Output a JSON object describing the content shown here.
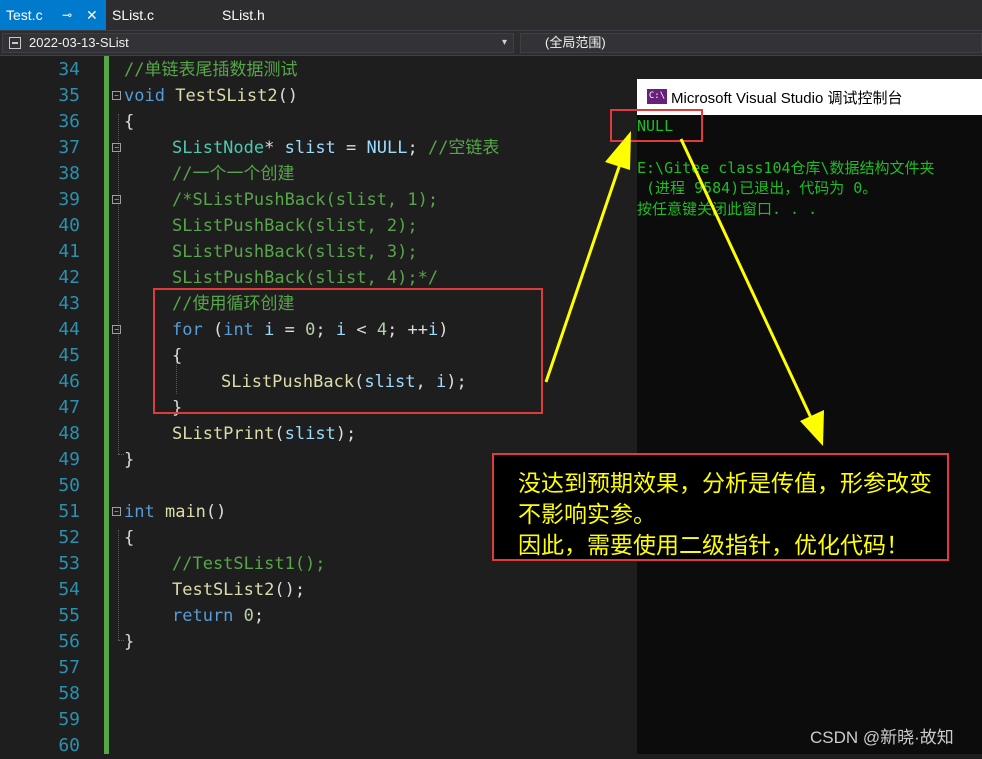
{
  "tabs": [
    {
      "label": "Test.c",
      "active": true,
      "pin": "⊸",
      "close": "✕"
    },
    {
      "label": "SList.c",
      "active": false
    },
    {
      "label": "SList.h",
      "active": false
    }
  ],
  "navbar": {
    "project": "2022-03-13-SList",
    "scope": "(全局范围)",
    "dropdown_arrow": "▾"
  },
  "editor": {
    "line_numbers": [
      "34",
      "35",
      "36",
      "37",
      "38",
      "39",
      "40",
      "41",
      "42",
      "43",
      "44",
      "45",
      "46",
      "47",
      "48",
      "49",
      "50",
      "51",
      "52",
      "53",
      "54",
      "55",
      "56",
      "57",
      "58",
      "59",
      "60"
    ],
    "code": {
      "l34": "//单链表尾插数据测试",
      "l35_kw": "void",
      "l35_fn": "TestSList2",
      "l35_rest": "()",
      "l36": "{",
      "l37_type": "SListNode",
      "l37_mid": "* ",
      "l37_var": "slist",
      "l37_eq": " = ",
      "l37_null": "NULL",
      "l37_semi": "; ",
      "l37_comment": "//空链表",
      "l38": "//一个一个创建",
      "l39": "/*SListPushBack(slist, 1);",
      "l40": "SListPushBack(slist, 2);",
      "l41": "SListPushBack(slist, 3);",
      "l42": "SListPushBack(slist, 4);*/",
      "l43": "//使用循环创建",
      "l44_for": "for",
      "l44_open": " (",
      "l44_int": "int",
      "l44_i1": " i",
      "l44_eq": " = ",
      "l44_zero": "0",
      "l44_semi1": "; ",
      "l44_i2": "i",
      "l44_lt": " < ",
      "l44_four": "4",
      "l44_semi2": "; ++",
      "l44_i3": "i",
      "l44_close": ")",
      "l45": "{",
      "l46_fn": "SListPushBack",
      "l46_open": "(",
      "l46_arg1": "slist",
      "l46_comma": ", ",
      "l46_arg2": "i",
      "l46_close": ");",
      "l47": "}",
      "l48_fn": "SListPrint",
      "l48_open": "(",
      "l48_arg": "slist",
      "l48_close": ");",
      "l49": "}",
      "l51_kw": "int",
      "l51_fn": "main",
      "l51_rest": "()",
      "l52": "{",
      "l53": "//TestSList1();",
      "l54_fn": "TestSList2",
      "l54_rest": "();",
      "l55_kw": "return",
      "l55_sp": " ",
      "l55_zero": "0",
      "l55_semi": ";",
      "l56": "}"
    },
    "fold_marker": "−"
  },
  "console": {
    "icon": "C:\\",
    "title": "Microsoft Visual Studio 调试控制台",
    "lines": [
      "NULL",
      "",
      "E:\\Gitee class104仓库\\数据结构文件夹",
      " (进程 9584)已退出，代码为 0。",
      "按任意键关闭此窗口. . ."
    ]
  },
  "callout": {
    "lines": [
      "没达到预期效果，分析是传值，形参改变",
      "不影响实参。",
      "因此，需要使用二级指针，优化代码！"
    ]
  },
  "watermark": "CSDN @新晓·故知",
  "colors": {
    "keyword": "#569cd6",
    "type": "#4ec9b0",
    "function": "#dcdcaa",
    "comment": "#57a64a",
    "number": "#b5cea8",
    "variable": "#9cdcfe",
    "line_number": "#2b91af",
    "annotation_red": "#e03a3a",
    "annotation_yellow": "#ffff00",
    "console_text": "#1dbd26"
  }
}
